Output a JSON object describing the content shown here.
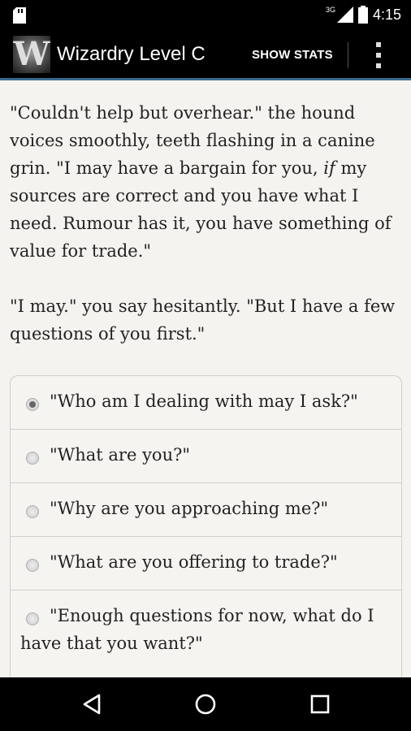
{
  "status_bar": {
    "network": "3G",
    "time": "4:15",
    "icons": [
      "sd-card-icon",
      "signal-icon",
      "battery-icon"
    ]
  },
  "app_bar": {
    "logo_letter": "W",
    "title": "Wizardry Level C",
    "show_stats_label": "SHOW STATS",
    "overflow_icon": "overflow-menu-icon"
  },
  "story": {
    "paragraph1_pre": "\"Couldn't help but overhear.\" the hound voices smoothly, teeth flashing in a canine grin. \"I may have a bargain for you, ",
    "paragraph1_emph": "if",
    "paragraph1_post": " my sources are correct and you have what I need. Rumour has it, you have something of value for trade.\"",
    "paragraph2": "\"I may.\" you say hesitantly. \"But I have a few questions of you first.\""
  },
  "choices": [
    {
      "label": "\"Who am I dealing with may I ask?\"",
      "selected": true
    },
    {
      "label": "\"What are you?\"",
      "selected": false
    },
    {
      "label": "\"Why are you approaching me?\"",
      "selected": false
    },
    {
      "label": "\"What are you offering to trade?\"",
      "selected": false
    },
    {
      "label": "\"Enough questions for now, what do I have that you want?\"",
      "selected": false
    }
  ],
  "nav_bar": {
    "icons": [
      "back-icon",
      "home-icon",
      "recents-icon"
    ]
  },
  "colors": {
    "background": "#f5f3ef",
    "app_bar": "#000000",
    "accent_line": "#3a6a8a",
    "text": "#222222"
  }
}
